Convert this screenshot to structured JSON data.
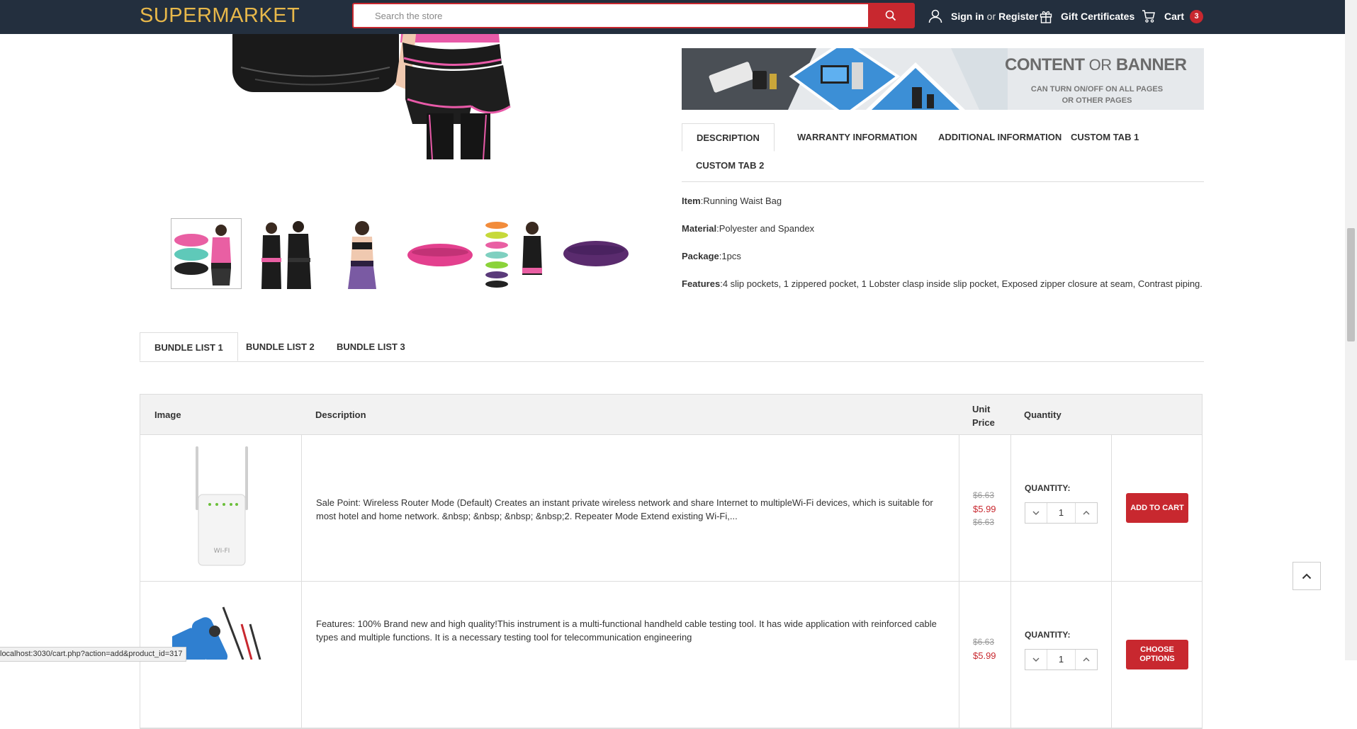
{
  "header": {
    "logo": "SUPERMARKET",
    "search_placeholder": "Search the store",
    "sign_in": "Sign in",
    "or": "or",
    "register": "Register",
    "gift": "Gift Certificates",
    "cart": "Cart",
    "cart_count": "3"
  },
  "banner": {
    "title_a": "CONTENT",
    "title_or": "OR",
    "title_b": "BANNER",
    "sub1": "CAN TURN ON/OFF ON ALL PAGES",
    "sub2": "OR OTHER PAGES"
  },
  "product_tabs": [
    "DESCRIPTION",
    "WARRANTY INFORMATION",
    "ADDITIONAL INFORMATION",
    "CUSTOM TAB 1",
    "CUSTOM TAB 2"
  ],
  "description": [
    {
      "label": "Item",
      "value": ":Running Waist Bag"
    },
    {
      "label": "Material",
      "value": ":Polyester and Spandex"
    },
    {
      "label": "Package",
      "value": ":1pcs"
    },
    {
      "label": "Features",
      "value": ":4 slip pockets, 1 zippered pocket, 1 Lobster clasp inside slip pocket, Exposed zipper closure at seam, Contrast piping."
    }
  ],
  "bundle_tabs": [
    "BUNDLE LIST 1",
    "BUNDLE LIST 2",
    "BUNDLE LIST 3"
  ],
  "table": {
    "headers": {
      "image": "Image",
      "description": "Description",
      "unit": "Unit",
      "price": "Price",
      "quantity": "Quantity"
    },
    "rows": [
      {
        "desc_line1": "Sale Point: Wireless Router Mode (Default) Creates an instant private wireless network and share Internet to multipleWi-Fi devices, which is suitable for",
        "desc_line2": "most hotel and home network. &nbsp; &nbsp; &nbsp; &nbsp;2. Repeater Mode Extend existing Wi-Fi,...",
        "price_old": "$6.63",
        "price_new": "$5.99",
        "price_old2": "$6.63",
        "qty_label": "QUANTITY:",
        "qty": "1",
        "cta": "ADD TO CART"
      },
      {
        "desc_line1": "Features: 100% Brand new and high quality!This instrument is a multi-functional handheld cable testing tool. It has wide application with reinforced cable",
        "desc_line2": "types and multiple functions. It is a necessary testing tool for telecommunication engineering",
        "price_old": "$6.63",
        "price_new": "$5.99",
        "qty_label": "QUANTITY:",
        "qty": "1",
        "cta": "CHOOSE OPTIONS"
      }
    ]
  },
  "device_label": "WI-FI",
  "status_url": "localhost:3030/cart.php?action=add&product_id=317",
  "colors": {
    "header": "#232f3e",
    "accent": "#c8282f",
    "logo": "#e8b84a"
  }
}
